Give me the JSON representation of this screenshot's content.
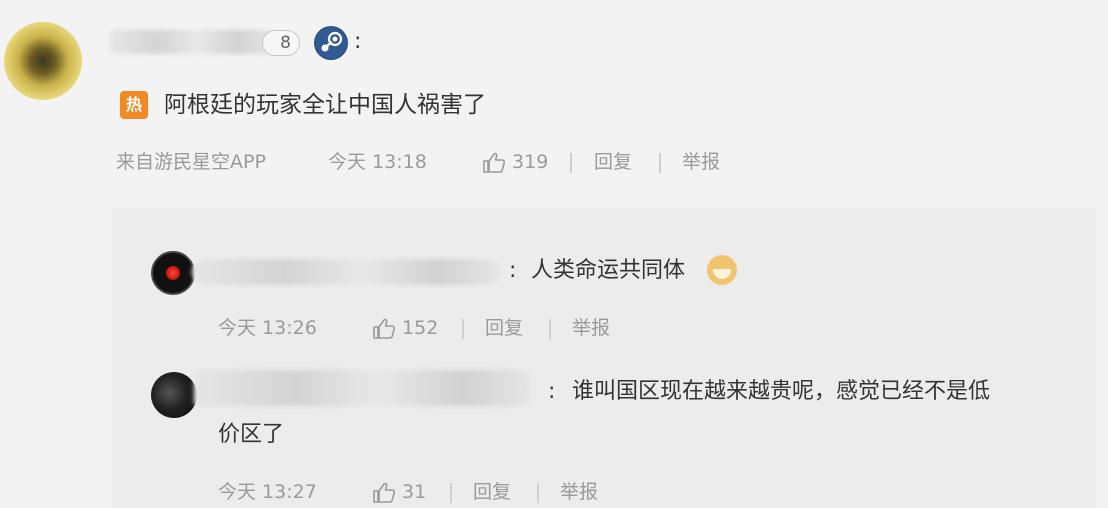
{
  "comment": {
    "level": "8",
    "colon": ":",
    "hot_icon_glyph": "热",
    "text": "阿根廷的玩家全让中国人祸害了",
    "source": "来自游民星空APP",
    "time": "今天 13:18",
    "likes": "319",
    "reply_label": "回复",
    "report_label": "举报"
  },
  "replies": [
    {
      "colon": ":",
      "text": "人类命运共同体",
      "emoji_icon": "dog-face-emoji",
      "time": "今天 13:26",
      "likes": "152",
      "reply_label": "回复",
      "report_label": "举报"
    },
    {
      "colon": ":",
      "text_line1": "谁叫国区现在越来越贵呢，感觉已经不是低",
      "text_line2": "价区了",
      "time": "今天 13:27",
      "likes": "31",
      "reply_label": "回复",
      "report_label": "举报"
    }
  ],
  "icons": {
    "steam": "steam-icon",
    "like": "thumbs-up-icon",
    "hot": "hot-badge-icon"
  },
  "colors": {
    "background": "#f3f3f3",
    "reply_background": "#ececec",
    "hot_badge": "#f08a24",
    "meta_text": "#9a9a9a",
    "body_text": "#333333"
  }
}
